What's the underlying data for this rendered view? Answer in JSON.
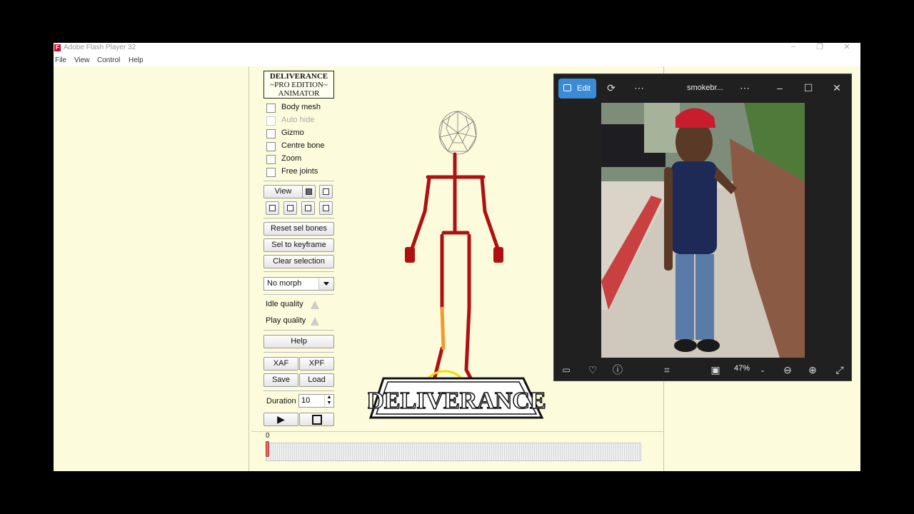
{
  "flash_window": {
    "title": "Adobe Flash Player 32",
    "menu": [
      "File",
      "View",
      "Control",
      "Help"
    ],
    "controls": [
      "–",
      "❐",
      "✕"
    ]
  },
  "panel": {
    "logo_lines": [
      "DELIVERANCE",
      "~PRO EDITION~",
      "ANIMATOR"
    ],
    "checkboxes": [
      {
        "label": "Body mesh",
        "enabled": true
      },
      {
        "label": "Auto hide",
        "enabled": false
      },
      {
        "label": "Gizmo",
        "enabled": true
      },
      {
        "label": "Centre bone",
        "enabled": true
      },
      {
        "label": "Zoom",
        "enabled": true
      },
      {
        "label": "Free joints",
        "enabled": true
      }
    ],
    "view_label": "View",
    "reset_label": "Reset sel bones",
    "keyframe_label": "Sel to keyframe",
    "clear_label": "Clear selection",
    "morph_value": "No morph",
    "idle_quality_label": "Idle quality",
    "play_quality_label": "Play quality",
    "help_label": "Help",
    "xaf_label": "XAF",
    "xpf_label": "XPF",
    "save_label": "Save",
    "load_label": "Load",
    "duration_label": "Duration",
    "duration_value": "10"
  },
  "stage": {
    "logo_text": "DELIVERANCE",
    "timeline_start": "0"
  },
  "photos_window": {
    "edit_label": "Edit",
    "filename": "smokebr...",
    "zoom_value": "47%",
    "colors": {
      "accent": "#3a8ad6",
      "background": "#202020"
    }
  }
}
